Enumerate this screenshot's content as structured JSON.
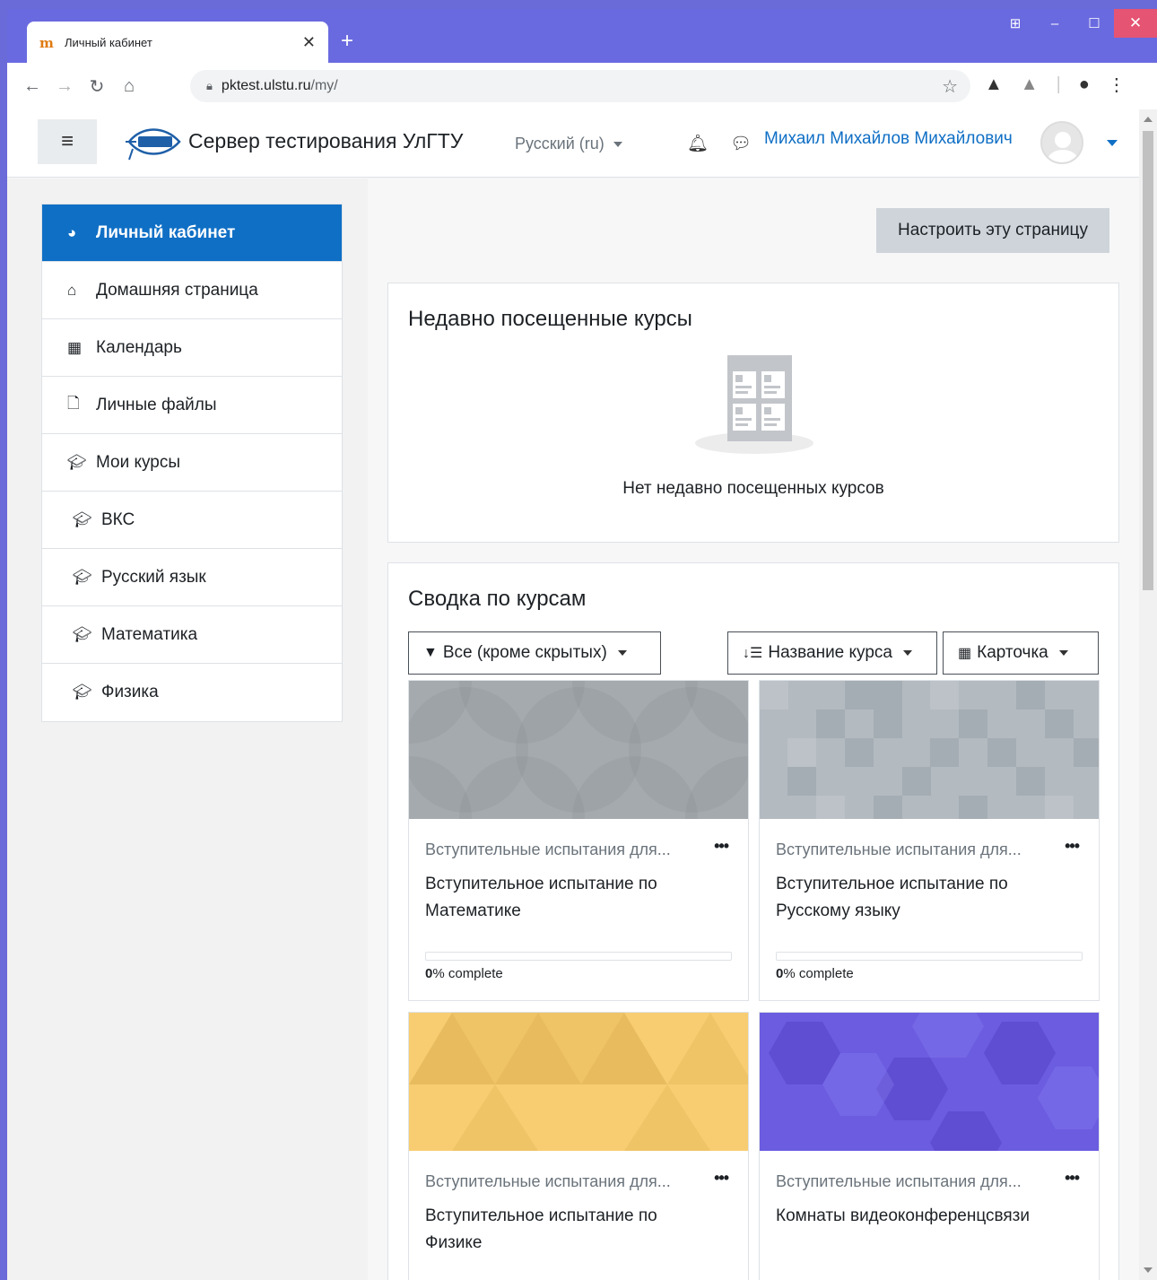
{
  "browser": {
    "tab_title": "Личный кабинет",
    "favicon": "moodle-m-icon",
    "url_host": "pktest.ulstu.ru",
    "url_path": "/my/"
  },
  "navbar": {
    "site_name": "Сервер тестирования УлГТУ",
    "language": "Русский (ru)",
    "user_name": "Михаил Михайлов Михайлович"
  },
  "sidebar": {
    "items": [
      {
        "label": "Личный кабинет",
        "icon": "dashboard-icon"
      },
      {
        "label": "Домашняя страница",
        "icon": "home-icon"
      },
      {
        "label": "Календарь",
        "icon": "calendar-icon"
      },
      {
        "label": "Личные файлы",
        "icon": "file-icon"
      },
      {
        "label": "Мои курсы",
        "icon": "graduation-cap-icon"
      },
      {
        "label": "ВКС",
        "icon": "graduation-cap-icon"
      },
      {
        "label": "Русский язык",
        "icon": "graduation-cap-icon"
      },
      {
        "label": "Математика",
        "icon": "graduation-cap-icon"
      },
      {
        "label": "Физика",
        "icon": "graduation-cap-icon"
      }
    ]
  },
  "main": {
    "customize_label": "Настроить эту страницу",
    "recent": {
      "title": "Недавно посещенные курсы",
      "empty_text": "Нет недавно посещенных курсов"
    },
    "overview": {
      "title": "Сводка по курсам",
      "filter_label": "Все (кроме скрытых)",
      "sort_label": "Название курса",
      "view_label": "Карточка",
      "courses": [
        {
          "category": "Вступительные испытания для...",
          "name": "Вступительное испытание по Математике",
          "progress": 0,
          "progress_num": "0",
          "progress_suffix": "% complete",
          "image_color": "#a6acb2"
        },
        {
          "category": "Вступительные испытания для...",
          "name": "Вступительное испытание по Русскому языку",
          "progress": 0,
          "progress_num": "0",
          "progress_suffix": "% complete",
          "image_color": "#adb5bd"
        },
        {
          "category": "Вступительные испытания для...",
          "name": "Вступительное испытание по Физике",
          "image_color": "#f5c96b"
        },
        {
          "category": "Вступительные испытания для...",
          "name": "Комнаты видеоконференцсвязи",
          "image_color": "#6a5ad8"
        }
      ]
    }
  }
}
